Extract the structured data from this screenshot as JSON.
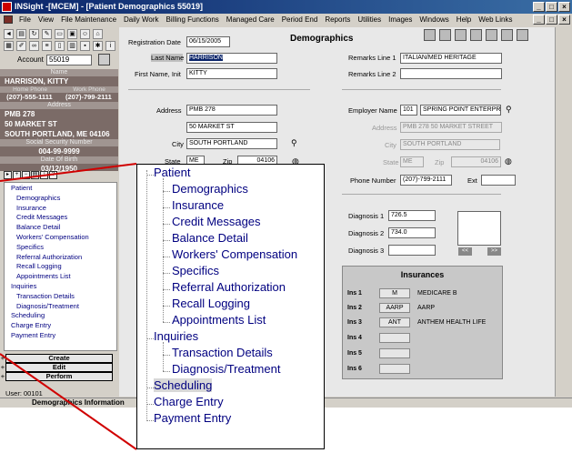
{
  "window": {
    "title": "INSight -[MCEM] - [Patient Demographics 55019]",
    "controls": [
      "_",
      "□",
      "×"
    ]
  },
  "menu": [
    "File",
    "View",
    "File Maintenance",
    "Daily Work",
    "Billing Functions",
    "Managed Care",
    "Period End",
    "Reports",
    "Utilities",
    "Images",
    "Windows",
    "Help",
    "Web Links"
  ],
  "account": {
    "label": "Account",
    "value": "55019"
  },
  "patient": {
    "name_header": "Name",
    "name": "HARRISON, KITTY",
    "home_phone_header": "Home Phone",
    "work_phone_header": "Work Phone",
    "home_phone": "(207)-555-1111",
    "work_phone": "(207)-799-2111",
    "address_header": "Address",
    "address1": "PMB 278",
    "address2": "50 MARKET ST",
    "address3": "SOUTH PORTLAND, ME 04106",
    "ssn_header": "Social Security Number",
    "ssn": "004-99-9999",
    "dob_header": "Date Of Birth",
    "dob": "03/12/1950"
  },
  "tree_small": [
    {
      "level": 0,
      "label": "Patient"
    },
    {
      "level": 1,
      "label": "Demographics"
    },
    {
      "level": 1,
      "label": "Insurance"
    },
    {
      "level": 1,
      "label": "Credit Messages"
    },
    {
      "level": 1,
      "label": "Balance Detail"
    },
    {
      "level": 1,
      "label": "Workers' Compensation"
    },
    {
      "level": 1,
      "label": "Specifics"
    },
    {
      "level": 1,
      "label": "Referral Authorization"
    },
    {
      "level": 1,
      "label": "Recall Logging"
    },
    {
      "level": 1,
      "label": "Appointments List"
    },
    {
      "level": 0,
      "label": "Inquiries"
    },
    {
      "level": 1,
      "label": "Transaction Details"
    },
    {
      "level": 1,
      "label": "Diagnosis/Treatment"
    },
    {
      "level": 0,
      "label": "Scheduling"
    },
    {
      "level": 0,
      "label": "Charge Entry"
    },
    {
      "level": 0,
      "label": "Payment Entry"
    }
  ],
  "actions": {
    "create": "Create",
    "edit": "Edit",
    "perform": "Perform"
  },
  "user": "User: 00101",
  "status": "Demographics Information",
  "form": {
    "title": "Demographics",
    "registration_date_label": "Registration Date",
    "registration_date": "06/15/2005",
    "last_name_label": "Last Name",
    "last_name": "HARRISON",
    "first_name_label": "First Name, Init",
    "first_name": "KITTY",
    "remarks1_label": "Remarks Line 1",
    "remarks1": "ITALIAN/MED HERITAGE",
    "remarks2_label": "Remarks Line 2",
    "remarks2": "",
    "address_label": "Address",
    "address1": "PMB 278",
    "address2": "50 MARKET ST",
    "city_label": "City",
    "city": "SOUTH PORTLAND",
    "state_label": "State",
    "state": "ME",
    "zip_label": "Zip",
    "zip": "04106",
    "employer_label": "Employer Name",
    "employer_code": "101",
    "employer_name": "SPRING POINT ENTERPR",
    "emp_address_label": "Address",
    "emp_address": "PMB 278 50 MARKET STREET",
    "emp_city_label": "City",
    "emp_city": "SOUTH PORTLAND",
    "emp_state_label": "State",
    "emp_state": "ME",
    "emp_zip_label": "Zip",
    "emp_zip": "04106",
    "phone_label": "Phone Number",
    "phone": "(207)-799-2111",
    "ext_label": "Ext",
    "ext": "",
    "diag1_label": "Diagnosis 1",
    "diag1": "726.5",
    "diag2_label": "Diagnosis 2",
    "diag2": "734.0",
    "diag3_label": "Diagnosis 3",
    "diag3": "",
    "prev_label": "<<",
    "next_label": ">>"
  },
  "insurances": {
    "title": "Insurances",
    "rows": [
      {
        "label": "Ins 1",
        "code": "M",
        "name": "MEDICARE B"
      },
      {
        "label": "Ins 2",
        "code": "AARP",
        "name": "AARP"
      },
      {
        "label": "Ins 3",
        "code": "ANT",
        "name": "ANTHEM HEALTH LIFE"
      },
      {
        "label": "Ins 4",
        "code": "",
        "name": ""
      },
      {
        "label": "Ins 5",
        "code": "",
        "name": ""
      },
      {
        "label": "Ins 6",
        "code": "",
        "name": ""
      }
    ]
  },
  "zoom_tree": [
    {
      "level": 0,
      "label": "Patient"
    },
    {
      "level": 1,
      "label": "Demographics"
    },
    {
      "level": 1,
      "label": "Insurance"
    },
    {
      "level": 1,
      "label": "Credit Messages"
    },
    {
      "level": 1,
      "label": "Balance Detail"
    },
    {
      "level": 1,
      "label": "Workers' Compensation"
    },
    {
      "level": 1,
      "label": "Specifics"
    },
    {
      "level": 1,
      "label": "Referral Authorization"
    },
    {
      "level": 1,
      "label": "Recall Logging"
    },
    {
      "level": 1,
      "label": "Appointments List"
    },
    {
      "level": 0,
      "label": "Inquiries"
    },
    {
      "level": 1,
      "label": "Transaction Details"
    },
    {
      "level": 1,
      "label": "Diagnosis/Treatment"
    },
    {
      "level": 0,
      "label": "Scheduling",
      "selected": true
    },
    {
      "level": 0,
      "label": "Charge Entry"
    },
    {
      "level": 0,
      "label": "Payment Entry"
    }
  ],
  "colors": {
    "titlebar": "#0a246a",
    "sidebar": "#7b6b67",
    "tree_text": "#000080",
    "callout_line": "#d00000"
  }
}
